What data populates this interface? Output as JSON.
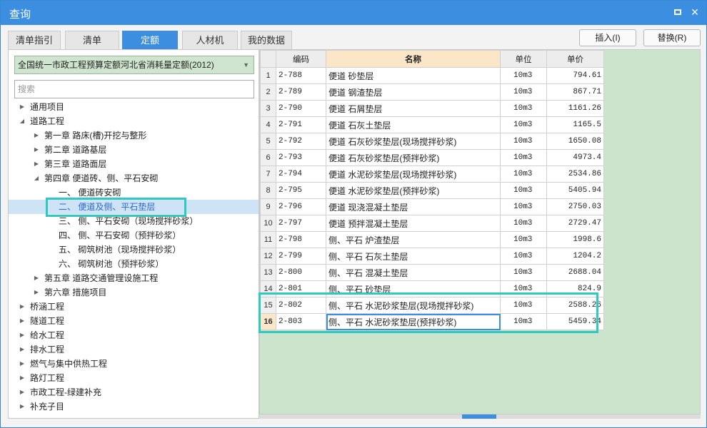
{
  "window": {
    "title": "查询",
    "maximize_glyph": "□",
    "close_glyph": "×"
  },
  "tabs": [
    {
      "label": "清单指引",
      "active": false
    },
    {
      "label": "清单",
      "active": false
    },
    {
      "label": "定额",
      "active": true
    },
    {
      "label": "人材机",
      "active": false
    },
    {
      "label": "我的数据",
      "active": false
    }
  ],
  "toolbar": {
    "insert_label": "插入(I)",
    "replace_label": "替换(R)"
  },
  "left": {
    "library": "全国统一市政工程预算定额河北省消耗量定额(2012)",
    "search_placeholder": "搜索",
    "tree": [
      {
        "label": "通用项目",
        "arrow": "▶"
      },
      {
        "label": "道路工程",
        "arrow": "◢"
      },
      {
        "label": "第一章 路床(槽)开挖与整形",
        "arrow": "▶"
      },
      {
        "label": "第二章 道路基层",
        "arrow": "▶"
      },
      {
        "label": "第三章 道路面层",
        "arrow": "▶"
      },
      {
        "label": "第四章 便道砖、侧、平石安砌",
        "arrow": "◢"
      },
      {
        "label": "一、 便道砖安砌",
        "arrow": ""
      },
      {
        "label": "二、 便道及侧、平石垫层",
        "arrow": ""
      },
      {
        "label": "三、 侧、平石安砌（现场搅拌砂浆）",
        "arrow": ""
      },
      {
        "label": "四、 侧、平石安砌（预拌砂浆）",
        "arrow": ""
      },
      {
        "label": "五、 砌筑树池（现场搅拌砂浆）",
        "arrow": ""
      },
      {
        "label": "六、 砌筑树池（预拌砂浆）",
        "arrow": ""
      },
      {
        "label": "第五章 道路交通管理设施工程",
        "arrow": "▶"
      },
      {
        "label": "第六章 措施项目",
        "arrow": "▶"
      },
      {
        "label": "桥涵工程",
        "arrow": "▶"
      },
      {
        "label": "隧道工程",
        "arrow": "▶"
      },
      {
        "label": "给水工程",
        "arrow": "▶"
      },
      {
        "label": "排水工程",
        "arrow": "▶"
      },
      {
        "label": "燃气与集中供热工程",
        "arrow": "▶"
      },
      {
        "label": "路灯工程",
        "arrow": "▶"
      },
      {
        "label": "市政工程-绿建补充",
        "arrow": "▶"
      },
      {
        "label": "补充子目",
        "arrow": "▶"
      }
    ]
  },
  "grid": {
    "headers": {
      "code": "编码",
      "name": "名称",
      "unit": "单位",
      "price": "单价"
    },
    "rows": [
      {
        "n": "1",
        "code": "2-788",
        "name": "便道 砂垫层",
        "unit": "10m3",
        "price": "794.61"
      },
      {
        "n": "2",
        "code": "2-789",
        "name": "便道 钢渣垫层",
        "unit": "10m3",
        "price": "867.71"
      },
      {
        "n": "3",
        "code": "2-790",
        "name": "便道 石屑垫层",
        "unit": "10m3",
        "price": "1161.26"
      },
      {
        "n": "4",
        "code": "2-791",
        "name": "便道 石灰土垫层",
        "unit": "10m3",
        "price": "1165.5"
      },
      {
        "n": "5",
        "code": "2-792",
        "name": "便道 石灰砂浆垫层(现场搅拌砂浆)",
        "unit": "10m3",
        "price": "1650.08"
      },
      {
        "n": "6",
        "code": "2-793",
        "name": "便道 石灰砂浆垫层(预拌砂浆)",
        "unit": "10m3",
        "price": "4973.4"
      },
      {
        "n": "7",
        "code": "2-794",
        "name": "便道 水泥砂浆垫层(现场搅拌砂浆)",
        "unit": "10m3",
        "price": "2534.86"
      },
      {
        "n": "8",
        "code": "2-795",
        "name": "便道 水泥砂浆垫层(预拌砂浆)",
        "unit": "10m3",
        "price": "5405.94"
      },
      {
        "n": "9",
        "code": "2-796",
        "name": "便道 现浇混凝土垫层",
        "unit": "10m3",
        "price": "2750.03"
      },
      {
        "n": "10",
        "code": "2-797",
        "name": "便道 预拌混凝土垫层",
        "unit": "10m3",
        "price": "2729.47"
      },
      {
        "n": "11",
        "code": "2-798",
        "name": "侧、平石 炉渣垫层",
        "unit": "10m3",
        "price": "1998.6"
      },
      {
        "n": "12",
        "code": "2-799",
        "name": "侧、平石 石灰土垫层",
        "unit": "10m3",
        "price": "1204.2"
      },
      {
        "n": "13",
        "code": "2-800",
        "name": "侧、平石 混凝土垫层",
        "unit": "10m3",
        "price": "2688.04"
      },
      {
        "n": "14",
        "code": "2-801",
        "name": "侧、平石 砂垫层",
        "unit": "10m3",
        "price": "824.9"
      },
      {
        "n": "15",
        "code": "2-802",
        "name": "侧、平石 水泥砂浆垫层(现场搅拌砂浆)",
        "unit": "10m3",
        "price": "2588.26"
      },
      {
        "n": "16",
        "code": "2-803",
        "name": "侧、平石 水泥砂浆垫层(预拌砂浆)",
        "unit": "10m3",
        "price": "5459.34"
      }
    ]
  },
  "colors": {
    "accent": "#3c8ee0",
    "highlight": "#31c8c0",
    "grid_bg": "#cbe4cb",
    "header_name": "#fbe6c7"
  }
}
